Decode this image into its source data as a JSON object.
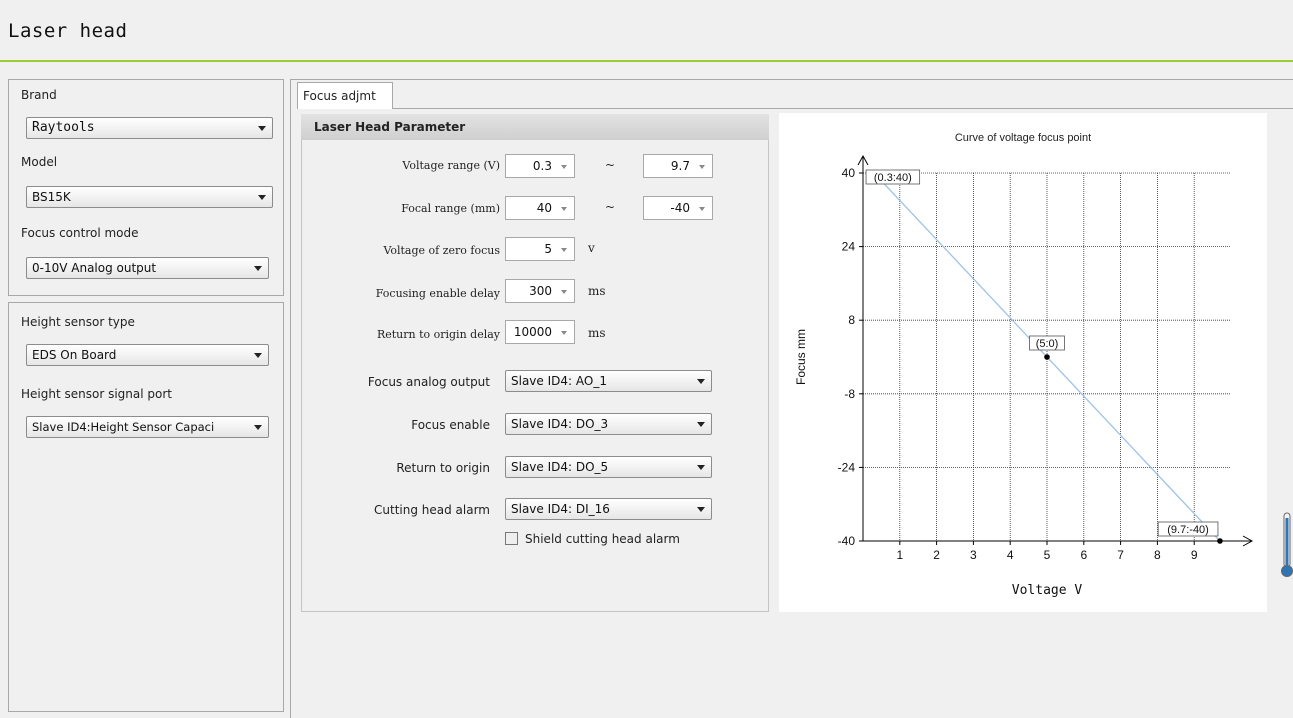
{
  "window": {
    "title": "Laser head"
  },
  "left": {
    "brand_label": "Brand",
    "brand_value": "Raytools",
    "model_label": "Model",
    "model_value": "BS15K",
    "focus_mode_label": "Focus control mode",
    "focus_mode_value": "0-10V Analog output",
    "height_type_label": "Height sensor type",
    "height_type_value": "EDS On Board",
    "height_port_label": "Height sensor signal port",
    "height_port_value": "Slave ID4:Height Sensor Capaci"
  },
  "tab": {
    "label": "Focus adjmt"
  },
  "params": {
    "header": "Laser Head Parameter",
    "voltage_range_label": "Voltage range (V)",
    "voltage_min": "0.3",
    "voltage_max": "9.7",
    "focal_range_label": "Focal range (mm)",
    "focal_min": "40",
    "focal_max": "-40",
    "tilde": "~",
    "zero_focus_label": "Voltage of zero focus",
    "zero_focus_value": "5",
    "zero_focus_unit": "v",
    "enable_delay_label": "Focusing enable delay",
    "enable_delay_value": "300",
    "enable_delay_unit": "ms",
    "origin_delay_label": "Return to origin delay",
    "origin_delay_value": "10000",
    "origin_delay_unit": "ms",
    "analog_output_label": "Focus analog output",
    "analog_output_value": "Slave ID4: AO_1",
    "focus_enable_label": "Focus enable",
    "focus_enable_value": "Slave ID4: DO_3",
    "return_origin_label": "Return to origin",
    "return_origin_value": "Slave ID4: DO_5",
    "alarm_label": "Cutting head alarm",
    "alarm_value": "Slave ID4: DI_16",
    "shield_label": "Shield cutting head alarm"
  },
  "chart_data": {
    "type": "line",
    "title": "Curve of voltage focus point",
    "xlabel": "Voltage V",
    "ylabel": "Focus mm",
    "xlim": [
      0,
      10
    ],
    "ylim": [
      -40,
      40
    ],
    "xticks": [
      1,
      2,
      3,
      4,
      5,
      6,
      7,
      8,
      9
    ],
    "yticks": [
      40,
      24,
      8,
      -8,
      -24,
      -40
    ],
    "grid": true,
    "line_color": "#9dc3e6",
    "x": [
      0.3,
      9.7
    ],
    "y": [
      40,
      -40
    ],
    "points": [
      {
        "x": 0.3,
        "y": 40,
        "label": "(0.3:40)"
      },
      {
        "x": 5,
        "y": 0,
        "label": "(5:0)"
      },
      {
        "x": 9.7,
        "y": -40,
        "label": "(9.7:-40)"
      }
    ]
  }
}
